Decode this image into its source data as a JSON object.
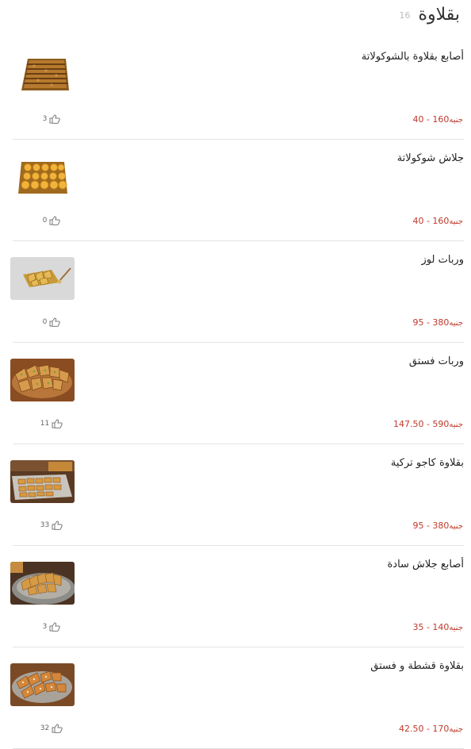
{
  "section": {
    "title": "بقلاوة",
    "count": "16"
  },
  "items": [
    {
      "name": "أصابع بقلاوة بالشوكولاتة",
      "price_min": "40",
      "price_max": "160",
      "currency": "جنيه",
      "likes": "3",
      "image": "chocolate-baklava-fingers-tray"
    },
    {
      "name": "جلاش شوكولاتة",
      "price_min": "40",
      "price_max": "160",
      "currency": "جنيه",
      "likes": "0",
      "image": "chocolate-phyllo-tray"
    },
    {
      "name": "وربات لوز",
      "price_min": "95",
      "price_max": "380",
      "currency": "جنيه",
      "likes": "0",
      "image": "almond-warbat-tray"
    },
    {
      "name": "وربات فستق",
      "price_min": "147.50",
      "price_max": "590",
      "currency": "جنيه",
      "likes": "11",
      "image": "pistachio-warbat-platter"
    },
    {
      "name": "بقلاوة كاجو تركية",
      "price_min": "95",
      "price_max": "380",
      "currency": "جنيه",
      "likes": "33",
      "image": "turkish-cashew-baklava-tray"
    },
    {
      "name": "أصابع جلاش سادة",
      "price_min": "35",
      "price_max": "140",
      "currency": "جنيه",
      "likes": "3",
      "image": "plain-phyllo-fingers-platter"
    },
    {
      "name": "بقلاوة قشطة و فستق",
      "price_min": "42.50",
      "price_max": "170",
      "currency": "جنيه",
      "likes": "32",
      "image": "cream-pistachio-baklava-platter"
    }
  ],
  "colors": {
    "price": "#c0392b",
    "divider": "#e3e3e3",
    "title": "#333333"
  },
  "icons": {
    "like": "thumbs-up-icon"
  }
}
